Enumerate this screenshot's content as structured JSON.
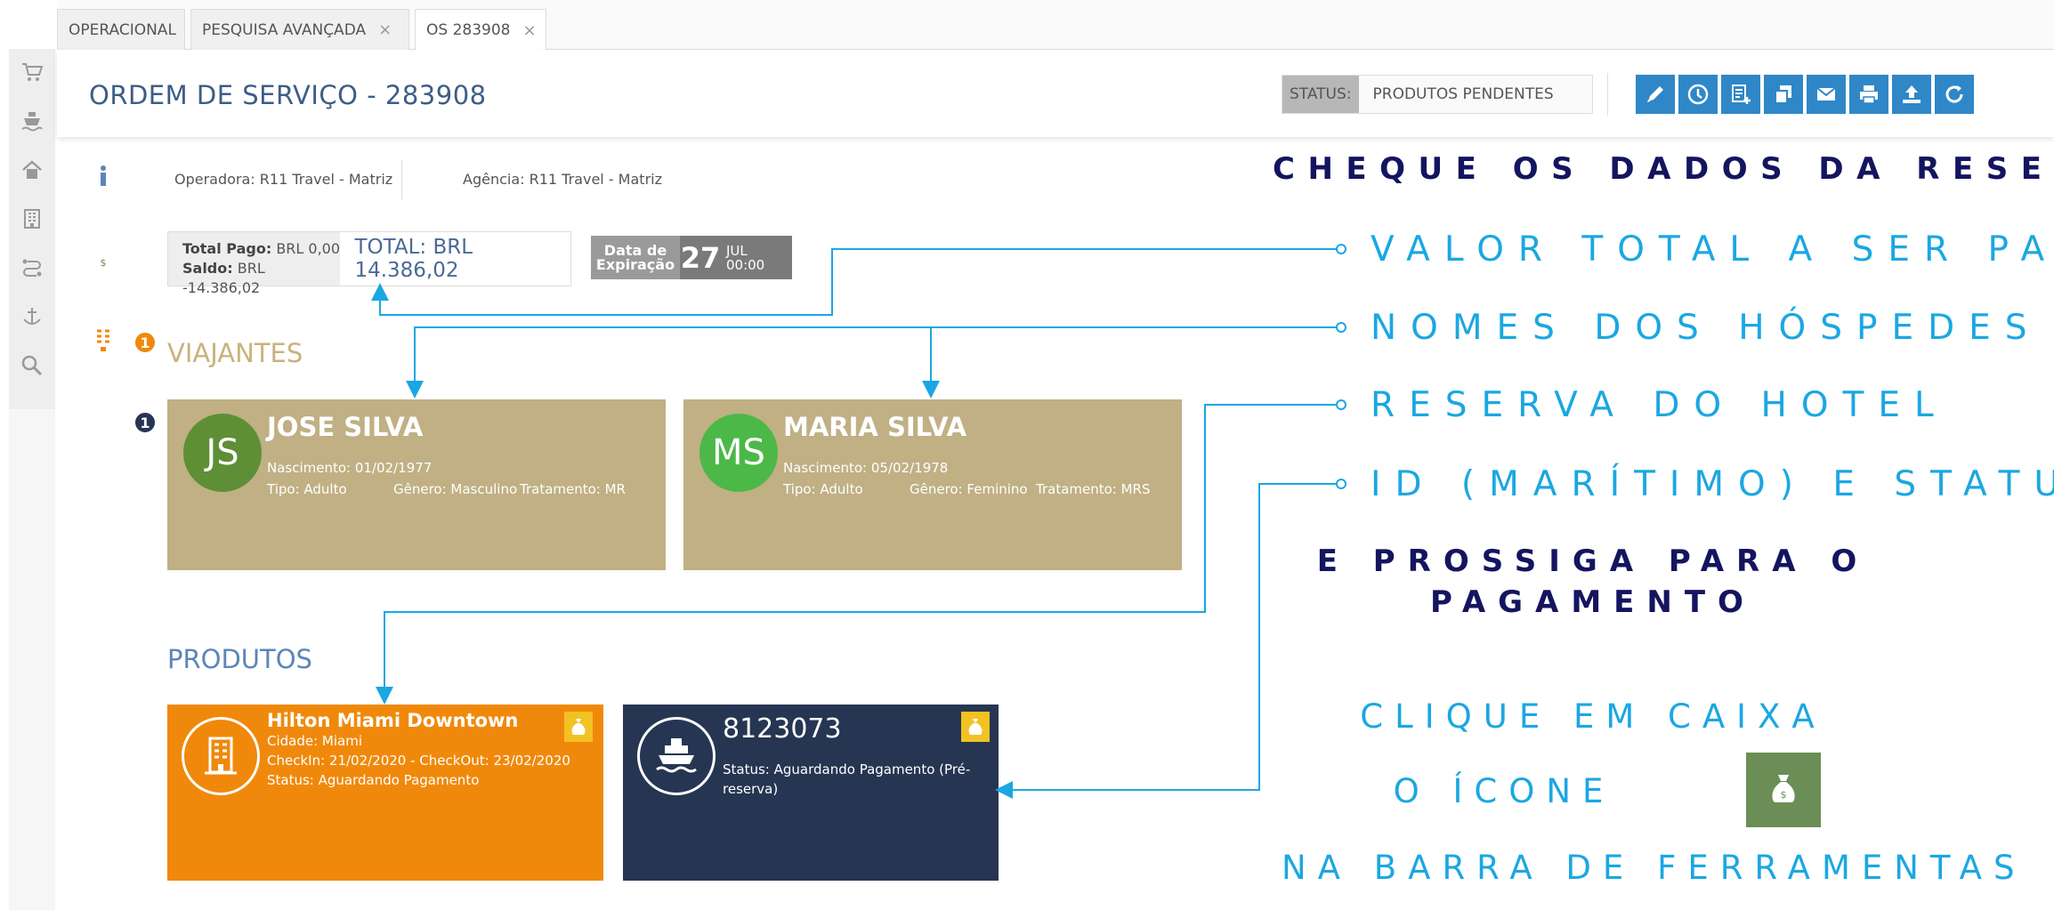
{
  "tabs": [
    {
      "label": "OPERACIONAL",
      "closable": false
    },
    {
      "label": "PESQUISA AVANÇADA",
      "closable": true,
      "close_glyph": "×"
    },
    {
      "label": "OS 283908",
      "closable": true,
      "close_glyph": "×",
      "active": true
    }
  ],
  "sidebar": {
    "items": [
      {
        "icon": "cart-icon"
      },
      {
        "icon": "ship-icon"
      },
      {
        "icon": "home-icon"
      },
      {
        "icon": "building-icon"
      },
      {
        "icon": "route-icon"
      },
      {
        "icon": "anchor-icon"
      },
      {
        "icon": "search-icon"
      }
    ]
  },
  "header": {
    "title": "ORDEM DE SERVIÇO - 283908",
    "status_label": "STATUS:",
    "status_value": "PRODUTOS PENDENTES",
    "tools": [
      {
        "icon": "pencil-icon"
      },
      {
        "icon": "history-icon"
      },
      {
        "icon": "add-document-icon"
      },
      {
        "icon": "copy-icon"
      },
      {
        "icon": "email-icon"
      },
      {
        "icon": "print-icon"
      },
      {
        "icon": "upload-icon"
      },
      {
        "icon": "refresh-icon"
      }
    ]
  },
  "vtoolbar": {
    "items": [
      {
        "icon": "info-icon",
        "color": "#5b86b8"
      },
      {
        "icon": "money-bag-icon",
        "color": "#6a8e56"
      },
      {
        "icon": "hotel-icon",
        "color": "#f0890b",
        "badge": "1"
      },
      {
        "icon": "cruise-icon",
        "color": "#263552",
        "badge": "1"
      }
    ]
  },
  "info": {
    "operator": "Operadora: R11 Travel - Matriz",
    "agency": "Agência: R11 Travel - Matriz"
  },
  "payment": {
    "paid_label": "Total Pago:",
    "paid_value": "BRL 0,00",
    "balance_label": "Saldo:",
    "balance_value": "BRL -14.386,02",
    "total": "TOTAL: BRL 14.386,02"
  },
  "expiration": {
    "label_line1": "Data de",
    "label_line2": "Expiração",
    "day": "27",
    "month": "JUL",
    "time": "00:00"
  },
  "travelers_title": "VIAJANTES",
  "travelers": [
    {
      "initials": "JS",
      "avatar_color": "#5e8f36",
      "name": "JOSE SILVA",
      "birth": "Nascimento: 01/02/1977",
      "type": "Tipo: Adulto",
      "gender": "Gênero: Masculino",
      "title": "Tratamento: MR"
    },
    {
      "initials": "MS",
      "avatar_color": "#4cb848",
      "name": "MARIA SILVA",
      "birth": "Nascimento: 05/02/1978",
      "type": "Tipo: Adulto",
      "gender": "Gênero: Feminino",
      "title": "Tratamento: MRS"
    }
  ],
  "products_title": "PRODUTOS",
  "products": [
    {
      "icon": "hotel-icon",
      "color": "#f0890b",
      "title": "Hilton Miami Downtown",
      "lines": [
        "Cidade: Miami",
        "CheckIn: 21/02/2020 - CheckOut: 23/02/2020",
        "Status: Aguardando Pagamento"
      ]
    },
    {
      "icon": "cruise-icon",
      "color": "#263552",
      "title": "8123073",
      "lines": [
        "Status: Aguardando Pagamento (Pré-",
        "reserva)"
      ]
    }
  ],
  "annotations": {
    "heading": "CHEQUE OS DADOS DA RESERVA",
    "callouts": [
      "VALOR TOTAL A SER PAGO",
      "NOMES DOS HÓSPEDES",
      "RESERVA DO HOTEL",
      "ID (MARÍTIMO) E STATUS"
    ],
    "next_step": "E PROSSIGA PARA O PAGAMENTO",
    "click_line1": "CLIQUE EM CAIXA",
    "click_line2": "O ÍCONE",
    "click_line3": "NA BARRA DE FERRAMENTAS",
    "icon": "money-bag-icon"
  },
  "colors": {
    "title_blue": "#3d5d86",
    "callout_blue": "#1ba7e2",
    "heading_navy": "#14155f",
    "traveler_tan": "#c0b084",
    "section_blue": "#5b86b8",
    "section_gold": "#c9b27c",
    "toolbar_blue": "#2f87c8"
  }
}
